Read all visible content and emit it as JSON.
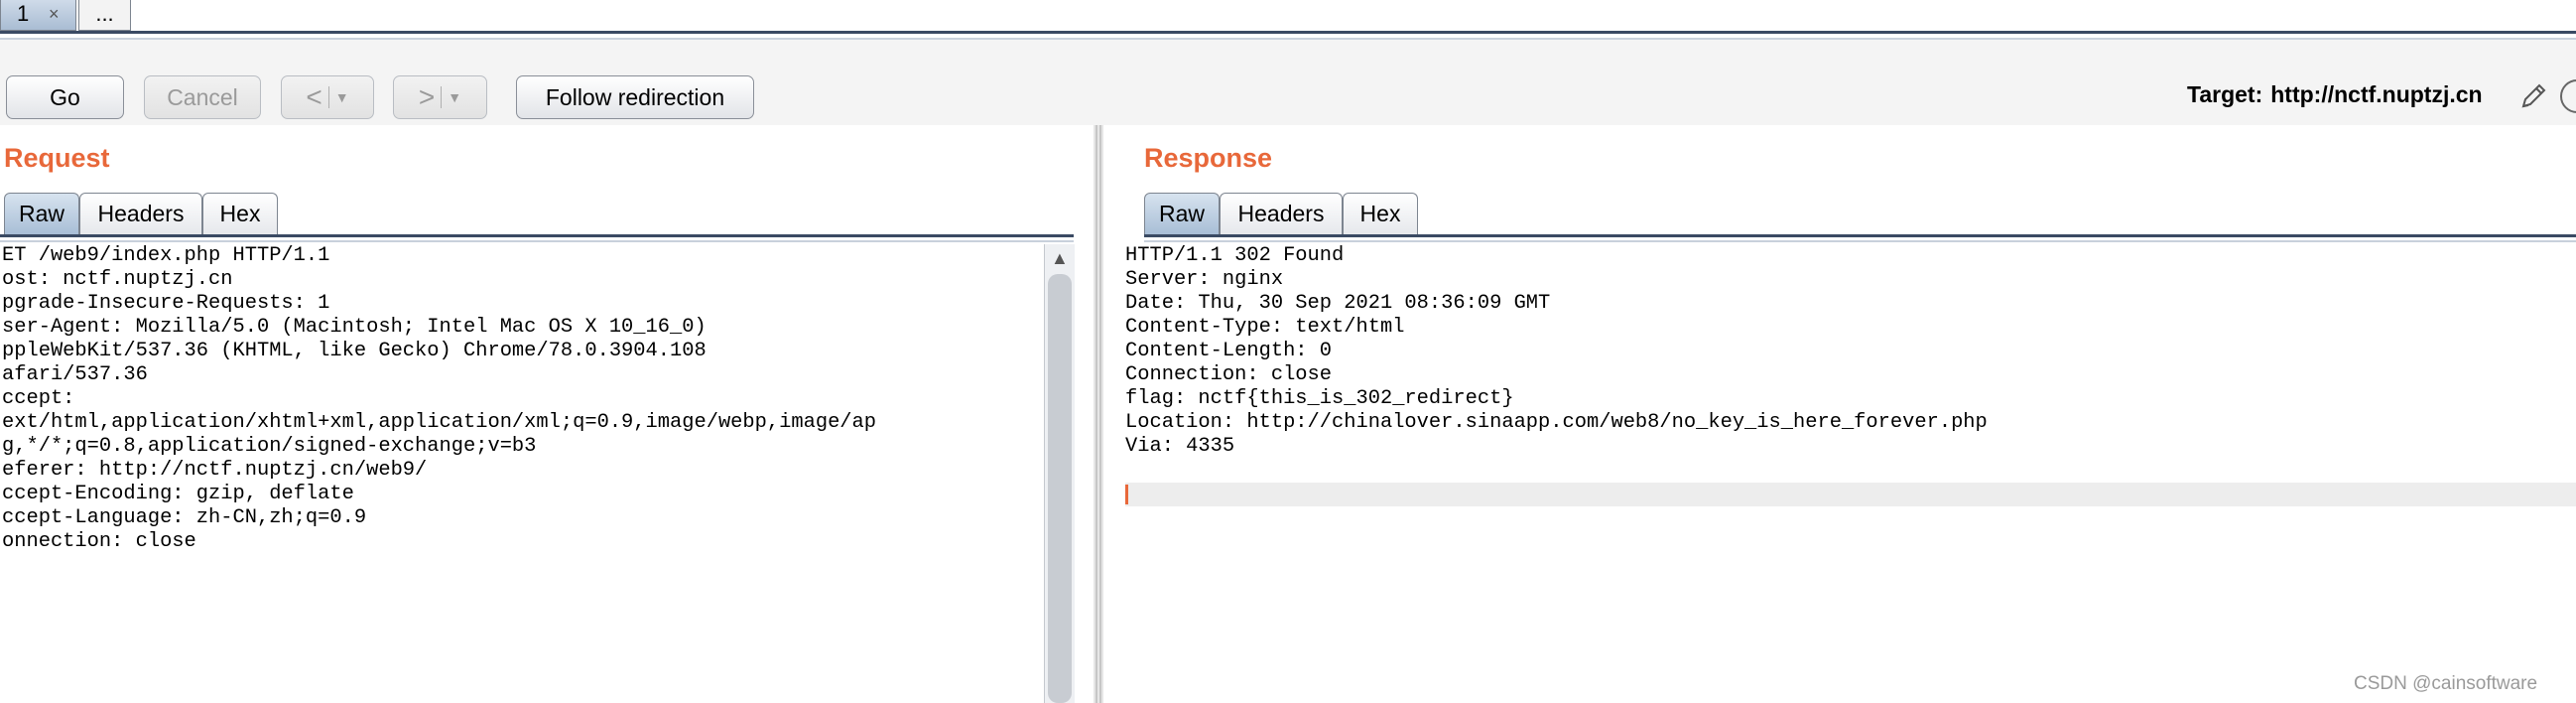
{
  "tabs": [
    {
      "label": "1",
      "close": "×"
    },
    {
      "label": "..."
    }
  ],
  "toolbar": {
    "go": "Go",
    "cancel": "Cancel",
    "back": "<",
    "forward": ">",
    "dropdown": "▼",
    "follow_redirection": "Follow redirection",
    "target_label": "Target:",
    "target_value": "http://nctf.nuptzj.cn"
  },
  "request": {
    "title": "Request",
    "tabs": [
      "Raw",
      "Headers",
      "Hex"
    ],
    "active_tab": "Raw",
    "body": "ET /web9/index.php HTTP/1.1\nost: nctf.nuptzj.cn\npgrade-Insecure-Requests: 1\nser-Agent: Mozilla/5.0 (Macintosh; Intel Mac OS X 10_16_0)\nppleWebKit/537.36 (KHTML, like Gecko) Chrome/78.0.3904.108\nafari/537.36\nccept:\next/html,application/xhtml+xml,application/xml;q=0.9,image/webp,image/ap\ng,*/*;q=0.8,application/signed-exchange;v=b3\neferer: http://nctf.nuptzj.cn/web9/\nccept-Encoding: gzip, deflate\nccept-Language: zh-CN,zh;q=0.9\nonnection: close"
  },
  "response": {
    "title": "Response",
    "tabs": [
      "Raw",
      "Headers",
      "Hex"
    ],
    "active_tab": "Raw",
    "body": "HTTP/1.1 302 Found\nServer: nginx\nDate: Thu, 30 Sep 2021 08:36:09 GMT\nContent-Type: text/html\nContent-Length: 0\nConnection: close\nflag: nctf{this_is_302_redirect}\nLocation: http://chinalover.sinaapp.com/web8/no_key_is_here_forever.php\nVia: 4335"
  },
  "watermark": "CSDN @cainsoftware",
  "colors": {
    "accent": "#e8683a",
    "tab_active": "#a8bed6",
    "tab_line": "#3a4a63"
  },
  "icons": {
    "close": "close-icon",
    "back": "chevron-left-icon",
    "forward": "chevron-right-icon",
    "dropdown": "dropdown-arrow-icon",
    "edit": "pencil-icon",
    "help": "circle-icon",
    "scroll_up": "scroll-up-arrow-icon"
  }
}
